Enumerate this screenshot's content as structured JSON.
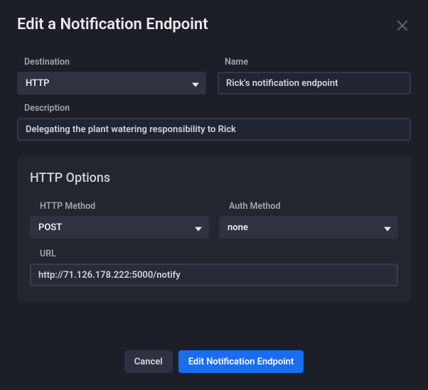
{
  "modal": {
    "title": "Edit a Notification Endpoint"
  },
  "labels": {
    "destination": "Destination",
    "name": "Name",
    "description": "Description"
  },
  "destination": {
    "value": "HTTP"
  },
  "name": {
    "value": "Rick's notification endpoint"
  },
  "description": {
    "value": "Delegating the plant watering responsibility to Rick"
  },
  "httpOptions": {
    "title": "HTTP Options",
    "labels": {
      "method": "HTTP Method",
      "auth": "Auth Method",
      "url": "URL"
    },
    "method": {
      "value": "POST"
    },
    "auth": {
      "value": "none"
    },
    "url": {
      "value": "http://71.126.178.222:5000/notify"
    }
  },
  "footer": {
    "cancel": "Cancel",
    "submit": "Edit Notification Endpoint"
  }
}
